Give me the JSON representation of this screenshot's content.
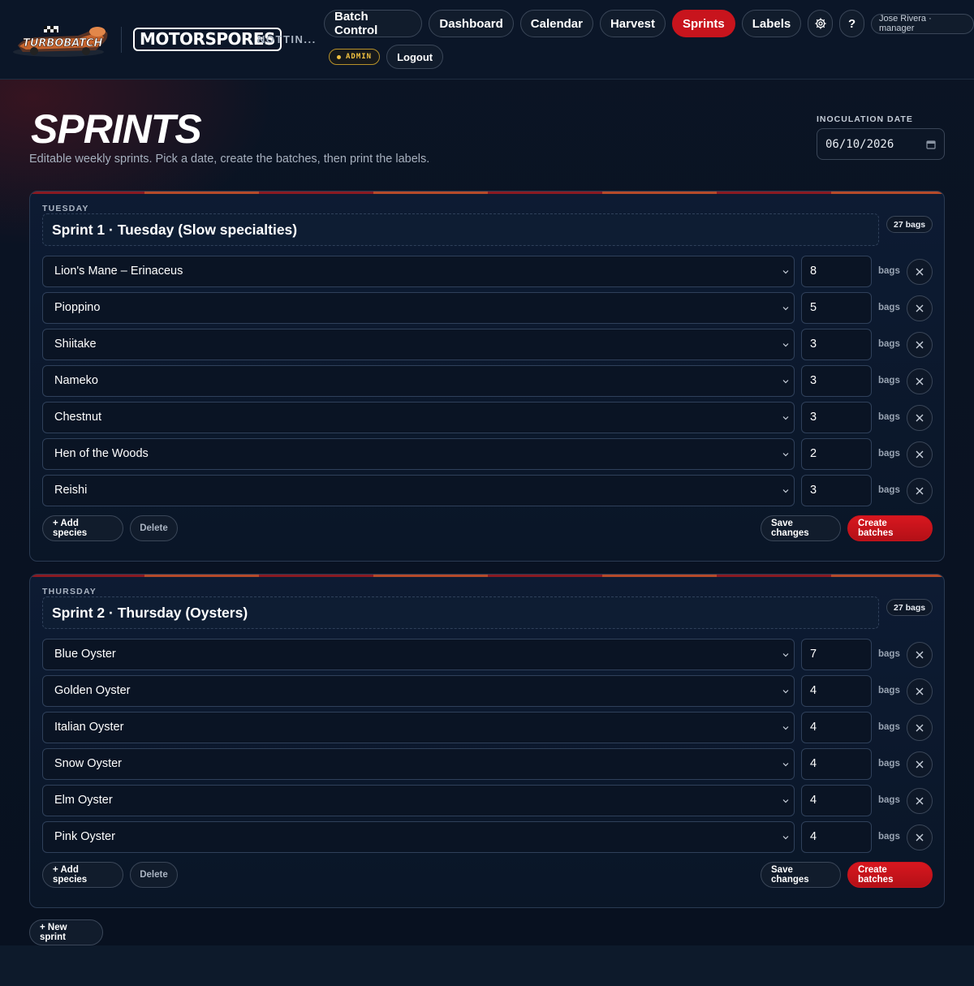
{
  "header": {
    "logo_text": "TURBOBATCH",
    "brand": "MOTORSPORES",
    "location": "NOTTIN...",
    "nav": [
      "Batch Control",
      "Dashboard",
      "Calendar",
      "Harvest",
      "Sprints",
      "Labels"
    ],
    "active_nav": "Sprints",
    "help_label": "?",
    "user": "Jose Rivera · manager",
    "role_badge": "ADMIN",
    "logout_label": "Logout"
  },
  "page": {
    "title": "SPRINTS",
    "subtitle": "Editable weekly sprints. Pick a date, create the batches, then print the labels.",
    "date_label": "INOCULATION DATE",
    "date_value": "06/10/2026"
  },
  "sprints": [
    {
      "day": "TUESDAY",
      "name": "Sprint 1 · Tuesday (Slow specialties)",
      "total": "27 bags",
      "rows": [
        {
          "species": "Lion's Mane – Erinaceus",
          "qty": "8"
        },
        {
          "species": "Pioppino",
          "qty": "5"
        },
        {
          "species": "Shiitake",
          "qty": "3"
        },
        {
          "species": "Nameko",
          "qty": "3"
        },
        {
          "species": "Chestnut",
          "qty": "3"
        },
        {
          "species": "Hen of the Woods",
          "qty": "2"
        },
        {
          "species": "Reishi",
          "qty": "3"
        }
      ]
    },
    {
      "day": "THURSDAY",
      "name": "Sprint 2 · Thursday (Oysters)",
      "total": "27 bags",
      "rows": [
        {
          "species": "Blue Oyster",
          "qty": "7"
        },
        {
          "species": "Golden Oyster",
          "qty": "4"
        },
        {
          "species": "Italian Oyster",
          "qty": "4"
        },
        {
          "species": "Snow Oyster",
          "qty": "4"
        },
        {
          "species": "Elm Oyster",
          "qty": "4"
        },
        {
          "species": "Pink Oyster",
          "qty": "4"
        }
      ]
    }
  ],
  "labels": {
    "unit": "bags",
    "add_species": "+ Add species",
    "delete": "Delete",
    "save": "Save changes",
    "create": "Create batches",
    "new_sprint": "+ New sprint"
  },
  "colors": {
    "accent": "#c8141d",
    "badge": "#f0c040",
    "background": "#0a1220"
  }
}
